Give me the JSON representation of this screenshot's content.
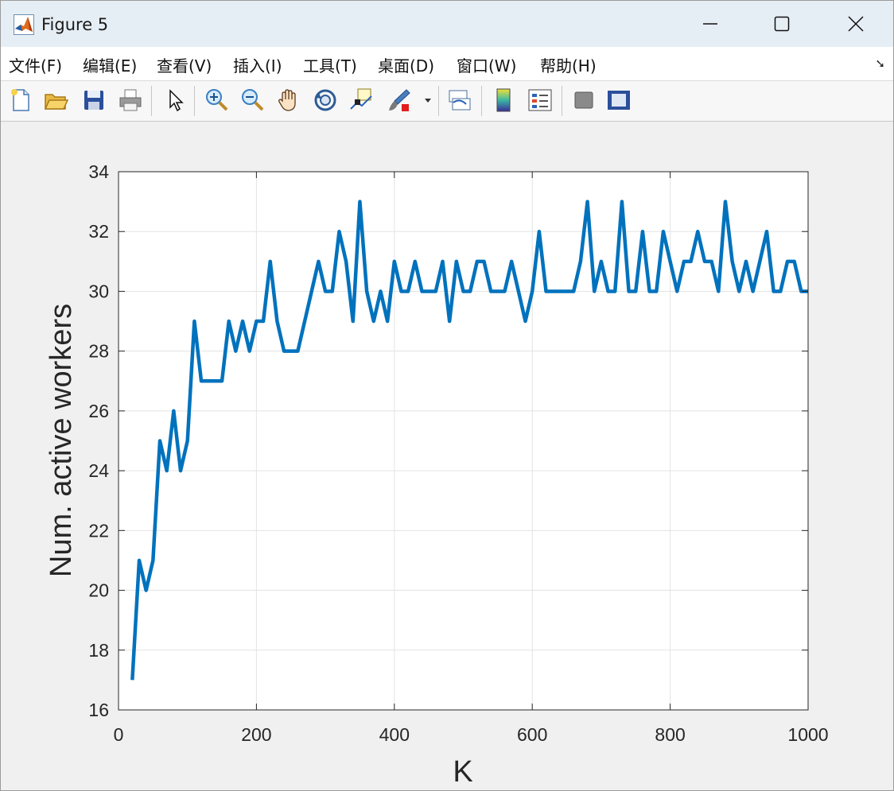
{
  "window": {
    "title": "Figure 5",
    "minimize_glyph": "—",
    "maximize_glyph": "☐",
    "close_glyph": "✕"
  },
  "menu": {
    "items": [
      "文件(F)",
      "编辑(E)",
      "查看(V)",
      "插入(I)",
      "工具(T)",
      "桌面(D)",
      "窗口(W)",
      "帮助(H)"
    ],
    "overflow_glyph": "➘"
  },
  "toolbar": {
    "icons": [
      "new-figure-icon",
      "open-file-icon",
      "save-icon",
      "print-icon",
      "pointer-icon",
      "zoom-in-icon",
      "zoom-out-icon",
      "pan-hand-icon",
      "rotate-3d-icon",
      "data-cursor-icon",
      "brush-icon",
      "link-plot-icon",
      "colorbar-icon",
      "legend-icon",
      "hide-plot-tools-icon",
      "show-plot-tools-icon"
    ]
  },
  "colors": {
    "line": "#0072bd",
    "axes_bg": "#ffffff",
    "figure_bg": "#f0f0f0",
    "grid": "#e3e3e3"
  },
  "chart_data": {
    "type": "line",
    "xlabel": "K",
    "ylabel": "Num. active workers",
    "xlim": [
      0,
      1000
    ],
    "ylim": [
      16,
      34
    ],
    "xticks": [
      0,
      200,
      400,
      600,
      800,
      1000
    ],
    "yticks": [
      16,
      18,
      20,
      22,
      24,
      26,
      28,
      30,
      32,
      34
    ],
    "grid": true,
    "series": [
      {
        "x": [
          20,
          30,
          40,
          50,
          60,
          70,
          80,
          90,
          100,
          110,
          120,
          130,
          140,
          150,
          160,
          170,
          180,
          190,
          200,
          210,
          220,
          230,
          240,
          250,
          260,
          270,
          280,
          290,
          300,
          310,
          320,
          330,
          340,
          350,
          360,
          370,
          380,
          390,
          400,
          410,
          420,
          430,
          440,
          450,
          460,
          470,
          480,
          490,
          500,
          510,
          520,
          530,
          540,
          550,
          560,
          570,
          580,
          590,
          600,
          610,
          620,
          630,
          640,
          650,
          660,
          670,
          680,
          690,
          700,
          710,
          720,
          730,
          740,
          750,
          760,
          770,
          780,
          790,
          800,
          810,
          820,
          830,
          840,
          850,
          860,
          870,
          880,
          890,
          900,
          910,
          920,
          930,
          940,
          950,
          960,
          970,
          980,
          990,
          1000
        ],
        "y": [
          17,
          21,
          20,
          21,
          25,
          24,
          26,
          24,
          25,
          29,
          27,
          27,
          27,
          27,
          29,
          28,
          29,
          28,
          29,
          29,
          31,
          29,
          28,
          28,
          28,
          29,
          30,
          31,
          30,
          30,
          32,
          31,
          29,
          33,
          30,
          29,
          30,
          29,
          31,
          30,
          30,
          31,
          30,
          30,
          30,
          31,
          29,
          31,
          30,
          30,
          31,
          31,
          30,
          30,
          30,
          31,
          30,
          29,
          30,
          32,
          30,
          30,
          30,
          30,
          30,
          31,
          33,
          30,
          31,
          30,
          30,
          33,
          30,
          30,
          32,
          30,
          30,
          32,
          31,
          30,
          31,
          31,
          32,
          31,
          31,
          30,
          33,
          31,
          30,
          31,
          30,
          31,
          32,
          30,
          30,
          31,
          31,
          30,
          30
        ]
      }
    ]
  }
}
